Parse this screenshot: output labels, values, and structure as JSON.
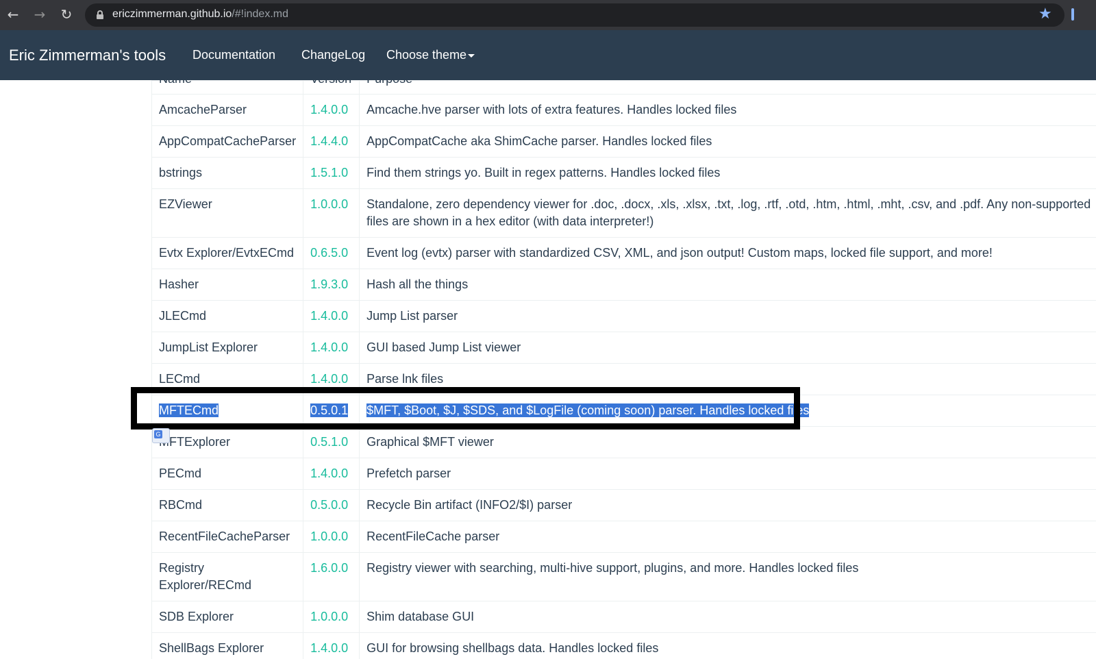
{
  "browser": {
    "url_host": "ericzimmerman.github.io",
    "url_path": "/#!index.md"
  },
  "site": {
    "brand": "Eric Zimmerman's tools",
    "nav": [
      "Documentation",
      "ChangeLog",
      "Choose theme"
    ]
  },
  "table": {
    "headers": [
      "Name",
      "Version",
      "Purpose"
    ],
    "rows": [
      {
        "name": "AmcacheParser",
        "version": "1.4.0.0",
        "purpose": "Amcache.hve parser with lots of extra features. Handles locked files"
      },
      {
        "name": "AppCompatCacheParser",
        "version": "1.4.4.0",
        "purpose": "AppCompatCache aka ShimCache parser. Handles locked files"
      },
      {
        "name": "bstrings",
        "version": "1.5.1.0",
        "purpose": "Find them strings yo. Built in regex patterns. Handles locked files"
      },
      {
        "name": "EZViewer",
        "version": "1.0.0.0",
        "purpose": "Standalone, zero dependency viewer for .doc, .docx, .xls, .xlsx, .txt, .log, .rtf, .otd, .htm, .html, .mht, .csv, and .pdf. Any non-supported files are shown in a hex editor (with data interpreter!)"
      },
      {
        "name": "Evtx Explorer/EvtxECmd",
        "version": "0.6.5.0",
        "purpose": "Event log (evtx) parser with standardized CSV, XML, and json output! Custom maps, locked file support, and more!"
      },
      {
        "name": "Hasher",
        "version": "1.9.3.0",
        "purpose": "Hash all the things"
      },
      {
        "name": "JLECmd",
        "version": "1.4.0.0",
        "purpose": "Jump List parser"
      },
      {
        "name": "JumpList Explorer",
        "version": "1.4.0.0",
        "purpose": "GUI based Jump List viewer"
      },
      {
        "name": "LECmd",
        "version": "1.4.0.0",
        "purpose": "Parse lnk files"
      },
      {
        "name": "MFTECmd",
        "version": "0.5.0.1",
        "purpose": "$MFT, $Boot, $J, $SDS, and $LogFile (coming soon) parser. Handles locked files",
        "selected": true
      },
      {
        "name": "MFTExplorer",
        "version": "0.5.1.0",
        "purpose": "Graphical $MFT viewer"
      },
      {
        "name": "PECmd",
        "version": "1.4.0.0",
        "purpose": "Prefetch parser"
      },
      {
        "name": "RBCmd",
        "version": "0.5.0.0",
        "purpose": "Recycle Bin artifact (INFO2/$I) parser"
      },
      {
        "name": "RecentFileCacheParser",
        "version": "1.0.0.0",
        "purpose": "RecentFileCache parser"
      },
      {
        "name": "Registry Explorer/RECmd",
        "version": "1.6.0.0",
        "purpose": "Registry viewer with searching, multi-hive support, plugins, and more. Handles locked files"
      },
      {
        "name": "SDB Explorer",
        "version": "1.0.0.0",
        "purpose": "Shim database GUI"
      },
      {
        "name": "ShellBags Explorer",
        "version": "1.4.0.0",
        "purpose": "GUI for browsing shellbags data. Handles locked files"
      }
    ]
  },
  "colors": {
    "navbar": "#2c3e50",
    "version_text": "#18bc9c",
    "selection": "#3875d7"
  }
}
